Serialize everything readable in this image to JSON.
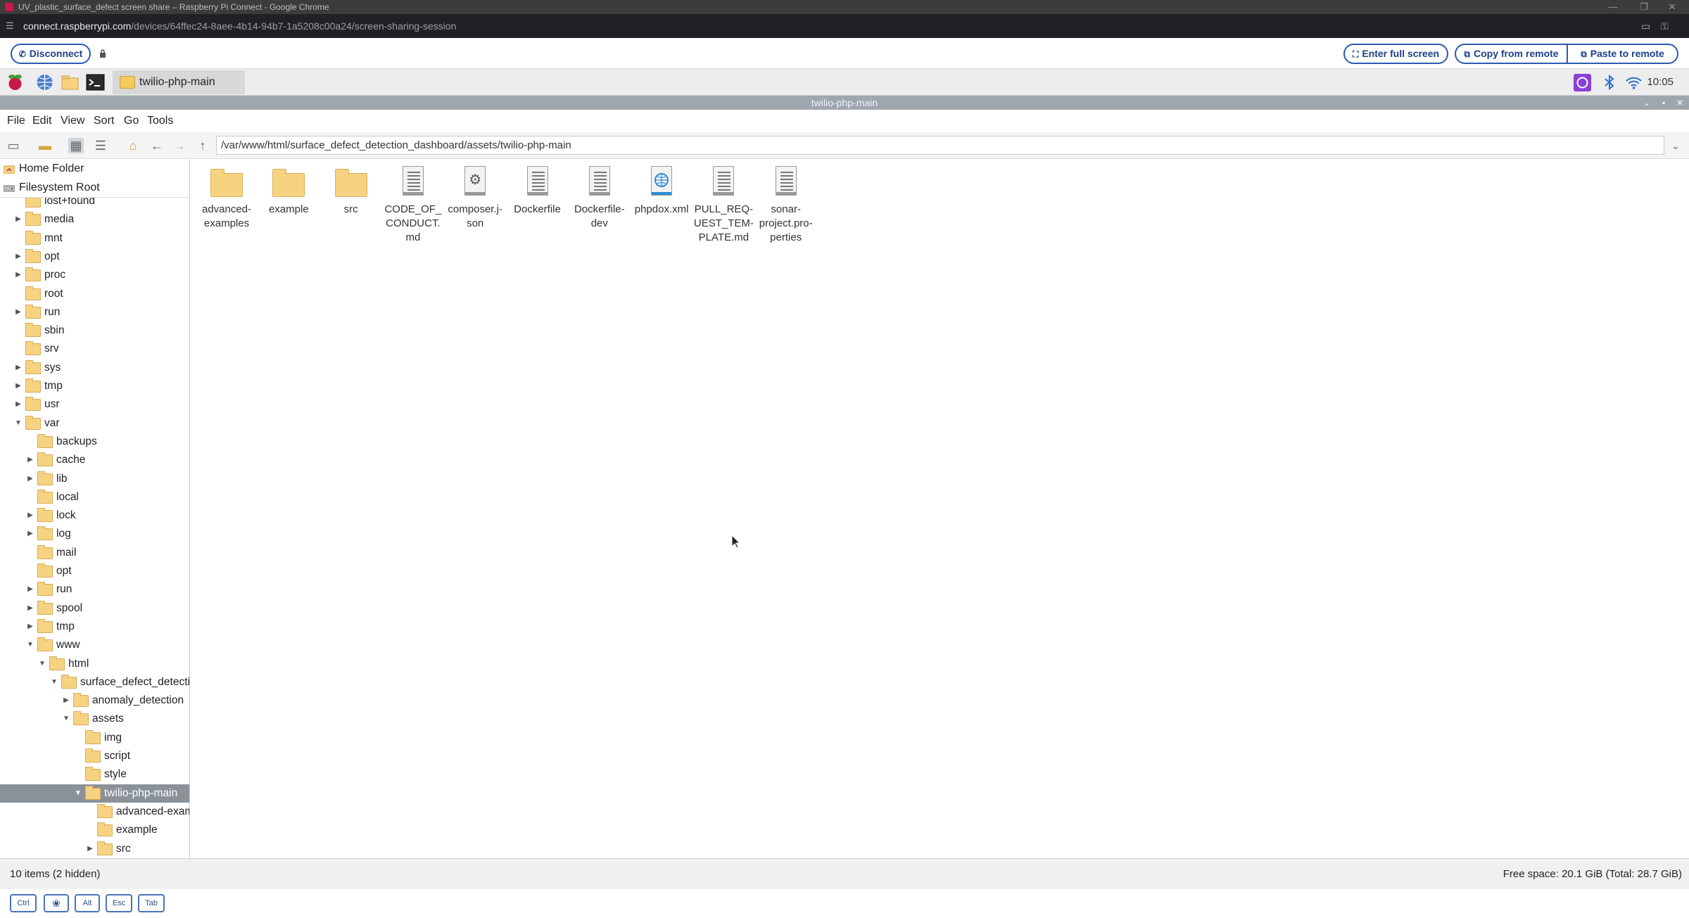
{
  "browser": {
    "window_title": "UV_plastic_surface_defect screen share – Raspberry Pi Connect - Google Chrome",
    "url_host": "connect.raspberrypi.com",
    "url_path": "/devices/64ffec24-8aee-4b14-94b7-1a5208c00a24/screen-sharing-session"
  },
  "connect": {
    "disconnect_label": "Disconnect",
    "fullscreen_label": "Enter full screen",
    "copy_label": "Copy from remote",
    "paste_label": "Paste to remote"
  },
  "panel": {
    "task_label": "twilio-php-main",
    "clock": "10:05"
  },
  "window": {
    "title": "twilio-php-main"
  },
  "menu": {
    "file": "File",
    "edit": "Edit",
    "view": "View",
    "sort": "Sort",
    "go": "Go",
    "tools": "Tools"
  },
  "toolbar": {
    "path": "/var/www/html/surface_defect_detection_dashboard/assets/twilio-php-main"
  },
  "places": {
    "home": "Home Folder",
    "root": "Filesystem Root"
  },
  "tree": [
    {
      "name": "lost+found",
      "expander": "",
      "depth": 0
    },
    {
      "name": "media",
      "expander": "▶",
      "depth": 0
    },
    {
      "name": "mnt",
      "expander": "",
      "depth": 0
    },
    {
      "name": "opt",
      "expander": "▶",
      "depth": 0
    },
    {
      "name": "proc",
      "expander": "▶",
      "depth": 0
    },
    {
      "name": "root",
      "expander": "",
      "depth": 0
    },
    {
      "name": "run",
      "expander": "▶",
      "depth": 0
    },
    {
      "name": "sbin",
      "expander": "",
      "depth": 0
    },
    {
      "name": "srv",
      "expander": "",
      "depth": 0
    },
    {
      "name": "sys",
      "expander": "▶",
      "depth": 0
    },
    {
      "name": "tmp",
      "expander": "▶",
      "depth": 0
    },
    {
      "name": "usr",
      "expander": "▶",
      "depth": 0
    },
    {
      "name": "var",
      "expander": "▼",
      "depth": 0
    },
    {
      "name": "backups",
      "expander": "",
      "depth": 1
    },
    {
      "name": "cache",
      "expander": "▶",
      "depth": 1
    },
    {
      "name": "lib",
      "expander": "▶",
      "depth": 1
    },
    {
      "name": "local",
      "expander": "",
      "depth": 1
    },
    {
      "name": "lock",
      "expander": "▶",
      "depth": 1
    },
    {
      "name": "log",
      "expander": "▶",
      "depth": 1
    },
    {
      "name": "mail",
      "expander": "",
      "depth": 1
    },
    {
      "name": "opt",
      "expander": "",
      "depth": 1
    },
    {
      "name": "run",
      "expander": "▶",
      "depth": 1
    },
    {
      "name": "spool",
      "expander": "▶",
      "depth": 1
    },
    {
      "name": "tmp",
      "expander": "▶",
      "depth": 1
    },
    {
      "name": "www",
      "expander": "▼",
      "depth": 1
    },
    {
      "name": "html",
      "expander": "▼",
      "depth": 2
    },
    {
      "name": "surface_defect_detection_dashboard",
      "expander": "▼",
      "depth": 3
    },
    {
      "name": "anomaly_detection",
      "expander": "▶",
      "depth": 4
    },
    {
      "name": "assets",
      "expander": "▼",
      "depth": 4
    },
    {
      "name": "img",
      "expander": "",
      "depth": 5
    },
    {
      "name": "script",
      "expander": "",
      "depth": 5
    },
    {
      "name": "style",
      "expander": "",
      "depth": 5
    },
    {
      "name": "twilio-php-main",
      "expander": "▼",
      "depth": 5,
      "selected": true
    },
    {
      "name": "advanced-examples",
      "expander": "",
      "depth": 6
    },
    {
      "name": "example",
      "expander": "",
      "depth": 6
    },
    {
      "name": "src",
      "expander": "▶",
      "depth": 6
    }
  ],
  "files": [
    {
      "name": "advanced-\nexamples",
      "kind": "folder"
    },
    {
      "name": "example",
      "kind": "folder"
    },
    {
      "name": "src",
      "kind": "folder"
    },
    {
      "name": "CODE_OF_\nCONDUCT.\nmd",
      "kind": "text"
    },
    {
      "name": "composer.j-\nson",
      "kind": "json"
    },
    {
      "name": "Dockerfile",
      "kind": "text"
    },
    {
      "name": "Dockerfile-\ndev",
      "kind": "text"
    },
    {
      "name": "phpdox.xml",
      "kind": "xml"
    },
    {
      "name": "PULL_REQ-\nUEST_TEM-\nPLATE.md",
      "kind": "text"
    },
    {
      "name": "sonar-\nproject.pro-\nperties",
      "kind": "text"
    }
  ],
  "status": {
    "items": "10 items (2 hidden)",
    "free": "Free space: 20.1 GiB (Total: 28.7 GiB)"
  },
  "keys": [
    "Ctrl",
    "",
    "Alt",
    "Esc",
    "Tab"
  ],
  "colors": {
    "accent": "#2c5ab0",
    "folder": "#f7d281",
    "selection": "#8a9199",
    "raspberry": "#c51a4a"
  }
}
